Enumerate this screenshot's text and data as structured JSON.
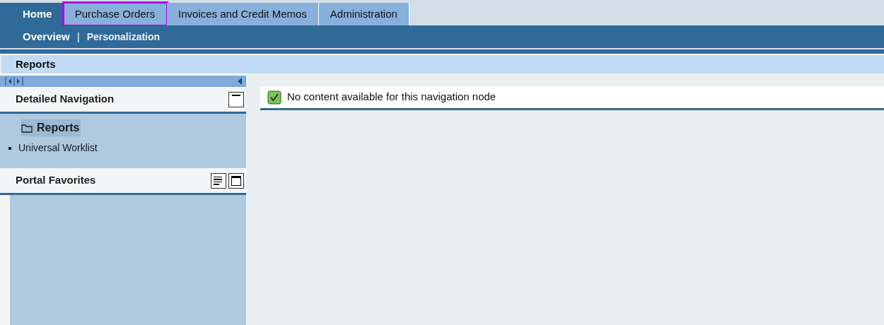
{
  "top_tabs": [
    {
      "label": "Home",
      "selected": true,
      "highlighted": false
    },
    {
      "label": "Purchase Orders",
      "selected": false,
      "highlighted": true
    },
    {
      "label": "Invoices and Credit Memos",
      "selected": false,
      "highlighted": false
    },
    {
      "label": "Administration",
      "selected": false,
      "highlighted": false
    }
  ],
  "sub_tabs": [
    {
      "label": "Overview",
      "selected": true
    },
    {
      "label": "Personalization",
      "selected": false
    }
  ],
  "sub_separator": "|",
  "page_title": "Reports",
  "detailed_navigation": {
    "title": "Detailed Navigation",
    "items": [
      {
        "label": "Reports",
        "kind": "folder",
        "selected": true
      },
      {
        "label": "Universal Worklist",
        "kind": "bullet",
        "selected": false
      }
    ]
  },
  "portal_favorites": {
    "title": "Portal Favorites"
  },
  "message": {
    "text": "No content available for this navigation node"
  }
}
